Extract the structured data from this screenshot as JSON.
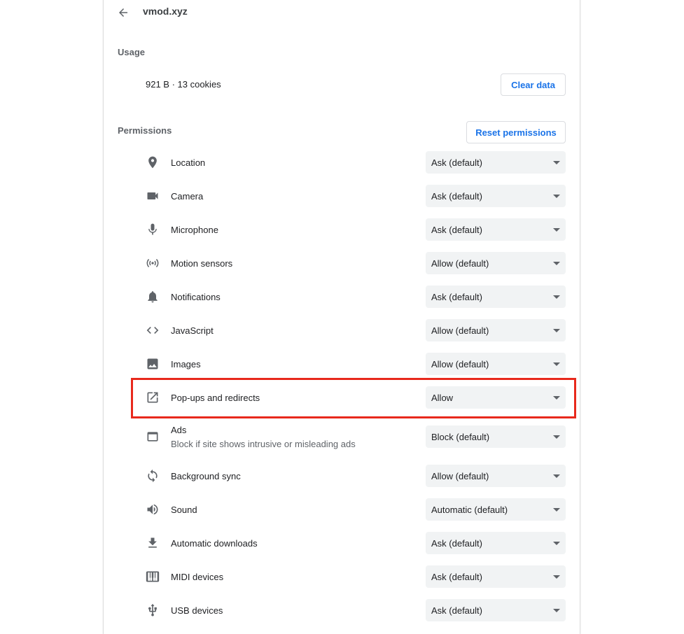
{
  "header": {
    "title": "vmod.xyz"
  },
  "usage": {
    "section_label": "Usage",
    "summary": "921 B · 13 cookies",
    "clear_button": "Clear data"
  },
  "permissions": {
    "section_label": "Permissions",
    "reset_button": "Reset permissions",
    "items": [
      {
        "label": "Location",
        "value": "Ask (default)",
        "icon": "location-pin-icon"
      },
      {
        "label": "Camera",
        "value": "Ask (default)",
        "icon": "camera-icon"
      },
      {
        "label": "Microphone",
        "value": "Ask (default)",
        "icon": "microphone-icon"
      },
      {
        "label": "Motion sensors",
        "value": "Allow (default)",
        "icon": "motion-sensors-icon"
      },
      {
        "label": "Notifications",
        "value": "Ask (default)",
        "icon": "bell-icon"
      },
      {
        "label": "JavaScript",
        "value": "Allow (default)",
        "icon": "code-brackets-icon"
      },
      {
        "label": "Images",
        "value": "Allow (default)",
        "icon": "image-icon"
      },
      {
        "label": "Pop-ups and redirects",
        "value": "Allow",
        "icon": "open-in-new-icon"
      },
      {
        "label": "Ads",
        "sublabel": "Block if site shows intrusive or misleading ads",
        "value": "Block (default)",
        "icon": "browser-window-icon"
      },
      {
        "label": "Background sync",
        "value": "Allow (default)",
        "icon": "sync-icon"
      },
      {
        "label": "Sound",
        "value": "Automatic (default)",
        "icon": "speaker-icon"
      },
      {
        "label": "Automatic downloads",
        "value": "Ask (default)",
        "icon": "download-icon"
      },
      {
        "label": "MIDI devices",
        "value": "Ask (default)",
        "icon": "piano-keys-icon"
      },
      {
        "label": "USB devices",
        "value": "Ask (default)",
        "icon": "usb-icon"
      }
    ]
  },
  "colors": {
    "accent": "#1a73e8",
    "highlight_border": "#e8291c",
    "select_bg": "#f1f3f4"
  }
}
